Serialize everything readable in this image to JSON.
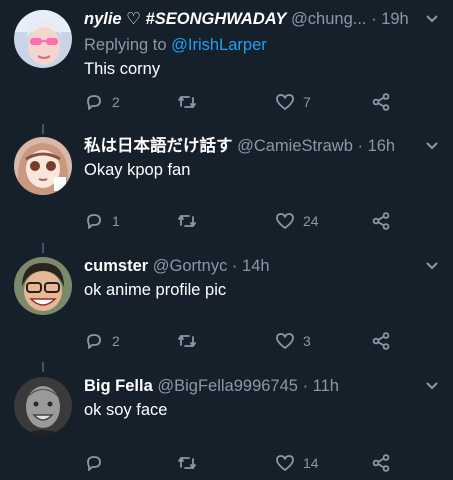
{
  "tweets": [
    {
      "name": "nylie ♡ #SEONGHWADAY",
      "handle": "@chung...",
      "dot": "·",
      "time": "19h",
      "replying_prefix": "Replying to ",
      "replying_to": "@IrishLarper",
      "text": "This corny",
      "replies": "2",
      "retweets": "",
      "likes": "7"
    },
    {
      "name": "私は日本語だけ話す",
      "handle": "@CamieStrawb",
      "dot": "·",
      "time": "16h",
      "text": "Okay kpop fan",
      "replies": "1",
      "retweets": "",
      "likes": "24"
    },
    {
      "name": "cumster",
      "handle": "@Gortnyc",
      "dot": "·",
      "time": "14h",
      "text": "ok anime profile pic",
      "replies": "2",
      "retweets": "",
      "likes": "3"
    },
    {
      "name": "Big Fella",
      "handle": "@BigFella9996745",
      "dot": "·",
      "time": "11h",
      "text": "ok soy face",
      "replies": "",
      "retweets": "",
      "likes": "14"
    }
  ],
  "colors": {
    "background": "#15202b",
    "muted": "#8899a6",
    "link": "#1da1f2",
    "thread_line": "#3d5466"
  },
  "icons": [
    "reply-icon",
    "retweet-icon",
    "like-icon",
    "share-icon",
    "chevron-down-icon"
  ]
}
